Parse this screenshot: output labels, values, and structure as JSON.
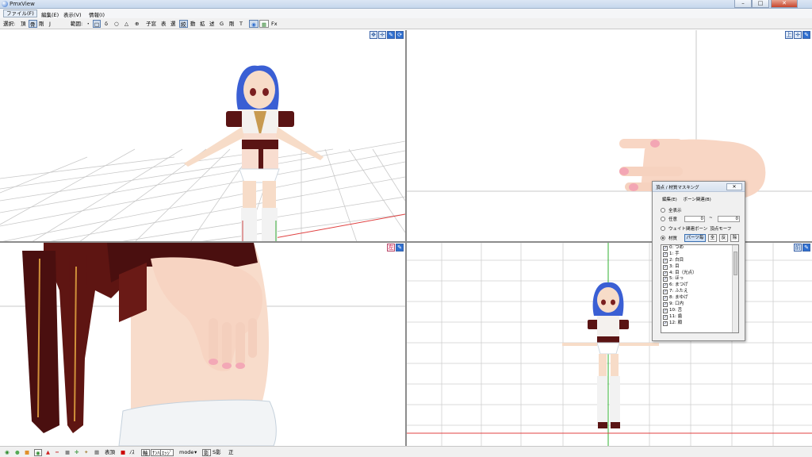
{
  "window": {
    "title": "PmxView",
    "buttons": {
      "minimize": "–",
      "maximize": "□",
      "close": "✕"
    }
  },
  "menu": {
    "file": "ファイル(F)",
    "edit": "編集(E)",
    "view": "表示(V)",
    "info": "情報(I)"
  },
  "toolbar": {
    "select_label": "選択:",
    "vertex": "頂",
    "bone": "骨",
    "rigid": "剛",
    "joint": "J",
    "range_label": "範囲:",
    "dot": "・",
    "rect": "□",
    "lasso": "δ",
    "circle": "○",
    "triangle": "△",
    "circle_plus": "⊕",
    "child_window": "子窓",
    "display": "表",
    "select_btn": "選",
    "disp_toggle": "絞",
    "move": "動",
    "scale": "拡",
    "rotate": "述",
    "g": "G",
    "rigid2": "剛",
    "t": "T",
    "fx": "Fx"
  },
  "viewports": {
    "top_left": {
      "icons": [
        "move-cross-icon",
        "move-arrows-icon",
        "pen-icon",
        "rotate-icon"
      ]
    },
    "top_right": {
      "icons": [
        "top-icon",
        "move-arrows-icon",
        "pen-icon"
      ],
      "label": "上"
    },
    "bottom_left": {
      "icons": [
        "left-icon",
        "pen-icon"
      ],
      "label": "左"
    },
    "bottom_right": {
      "icons": [
        "front-icon",
        "pen-icon"
      ],
      "label": "前"
    }
  },
  "dialog": {
    "title": "頂点 / 材質マスキング",
    "close": "✕",
    "menu_edit": "編集(E)",
    "menu_bone": "ボーン関連(B)",
    "opt_all": "全表示",
    "opt_any": "任意",
    "any_from": "0",
    "any_sep": "~",
    "any_to": "0",
    "opt_weight": "ウェイト関連ボーン",
    "opt_vertex_morph": "頂点モーフ",
    "opt_material": "材質",
    "btn_parts": "パーツ毎",
    "btn_all": "全",
    "btn_invert": "反",
    "btn_remove": "除",
    "materials": [
      "0: つめ",
      "1: 手",
      "2: 白目",
      "3: 目",
      "4: 目（光点）",
      "5: ほっ",
      "6: まつげ",
      "7: ふたえ",
      "8: まゆげ",
      "9: 口内",
      "10: 舌",
      "11: 歯",
      "12: 顔"
    ]
  },
  "statusbar": {
    "surface": "表頂",
    "n": "ﾉｽ",
    "axis": "軸",
    "num": "ﾅﾝﾊﾞ",
    "edge": "ｴｯｼﾞ",
    "mode": "mode",
    "shadow": "影",
    "s_shadow": "S影",
    "front": "正"
  },
  "colors": {
    "accent": "#2f6fd0",
    "grid": "#c8c8c8",
    "axis_red": "#e04040",
    "axis_green": "#30b030",
    "skin": "#f7d9c6",
    "hair": "#3a5fd4",
    "outfit_red": "#5a1414"
  }
}
